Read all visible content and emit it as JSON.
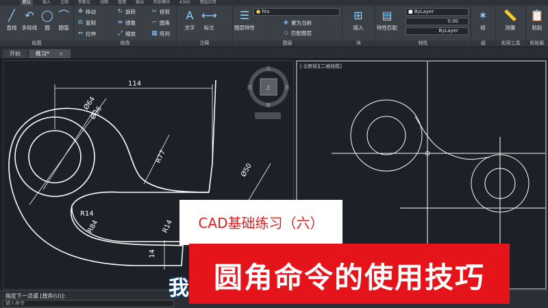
{
  "ribbon": {
    "tabs": [
      "默认",
      "插入",
      "注释",
      "参数化",
      "视图",
      "管理",
      "输出",
      "附加模块",
      "A360",
      "精选应用"
    ],
    "draw": {
      "label": "绘图",
      "tools": [
        "直线",
        "多段线",
        "圆",
        "圆弧"
      ]
    },
    "modify": {
      "label": "修改",
      "tools": [
        "移动",
        "旋转",
        "修剪",
        "复制",
        "镜像",
        "圆角",
        "拉伸",
        "缩放",
        "阵列"
      ]
    },
    "annotation": {
      "label": "注释",
      "tools": [
        "文字",
        "标注"
      ]
    },
    "layers": {
      "label": "图层",
      "tools": [
        "图层特性",
        "置为当前",
        "匹配图层"
      ],
      "current_layer": "htx"
    },
    "block": {
      "label": "块",
      "tools": [
        "插入"
      ]
    },
    "properties": {
      "label": "特性",
      "tools": [
        "特性匹配"
      ],
      "color": "ByLayer",
      "lineweight": "0.00",
      "linetype": "ByLayer"
    },
    "groups": {
      "label": "组",
      "tools": [
        "组"
      ]
    },
    "utilities": {
      "label": "实用工具",
      "tools": [
        "测量"
      ]
    },
    "clipboard": {
      "label": "剪贴板",
      "tools": [
        "粘贴"
      ]
    }
  },
  "doc_tabs": [
    "开始",
    "练习*"
  ],
  "viewport_left": {
    "dimensions": [
      "114",
      "Ø64",
      "Ø36",
      "R77",
      "Ø50",
      "R14",
      "R84",
      "R14",
      "14"
    ],
    "viewcube": {
      "north": "北",
      "south": "南",
      "west": "西",
      "east": "东",
      "top": "上"
    }
  },
  "viewport_right": {
    "label": "[-][俯视][二维线框]"
  },
  "command_line": {
    "prompt": "指定下一点或 [放弃(U)]:",
    "placeholder": "键入命令"
  },
  "overlay": {
    "subtitle": "CAD基础练习（六）",
    "title": "圆角命令的使用技巧",
    "caption_fragment": "我"
  },
  "colors": {
    "accent_red": "#e4141a",
    "subtitle_red": "#d81e1e",
    "canvas": "#1d2127"
  }
}
